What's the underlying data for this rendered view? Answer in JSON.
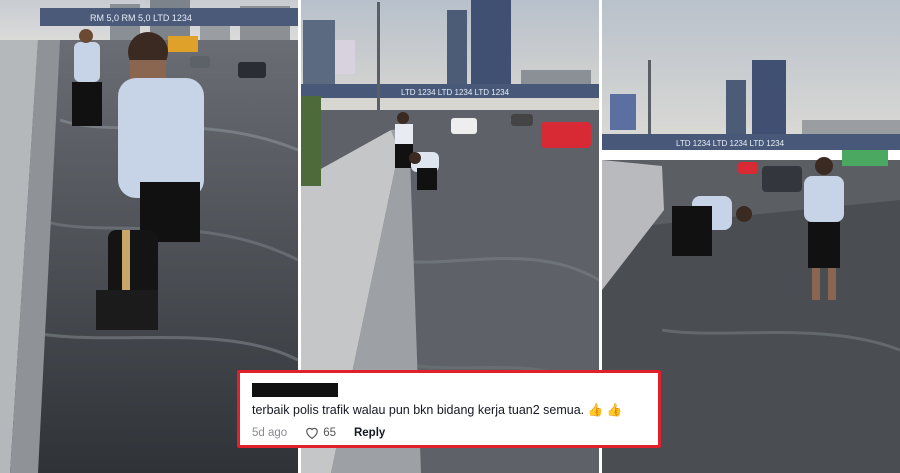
{
  "comment": {
    "text": "terbaik polis trafik walau pun bkn bidang kerja tuan2 semua.",
    "emojis": "👍 👍",
    "time_ago": "5d ago",
    "likes": "65",
    "reply_label": "Reply",
    "like_icon": "heart-icon"
  },
  "panels": {
    "panel_1": {
      "billboard_text": "RM 5,0 RM 5,0 LTD 1234"
    },
    "panel_2": {
      "gantry_text": "LTD 1234 LTD 1234 LTD 1234"
    },
    "panel_3": {
      "gantry_text": "LTD 1234 LTD 1234 LTD 1234"
    }
  },
  "colors": {
    "highlight_border": "#e0202a",
    "uniform_shirt": "#c7d3e6",
    "water": "#4a4f57"
  }
}
